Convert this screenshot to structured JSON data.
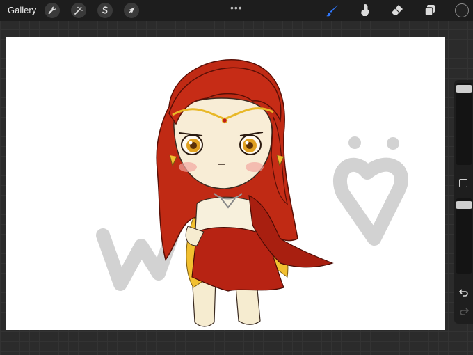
{
  "topbar": {
    "gallery_label": "Gallery",
    "more_menu": "•••"
  },
  "colors": {
    "active_brush": "#2f78ff",
    "topbar_bg": "#1d1d1d",
    "canvas_bg": "#ffffff",
    "current_color": "#222222"
  },
  "left_tools": [
    "wrench-icon",
    "magic-wand-icon",
    "selection-s-icon",
    "arrow-cursor-icon"
  ],
  "right_tools": [
    "brush-icon",
    "smudge-icon",
    "eraser-icon",
    "layers-icon",
    "color-picker-icon"
  ],
  "sidebar": {
    "brush_size": 0.07,
    "opacity": 0.05
  }
}
